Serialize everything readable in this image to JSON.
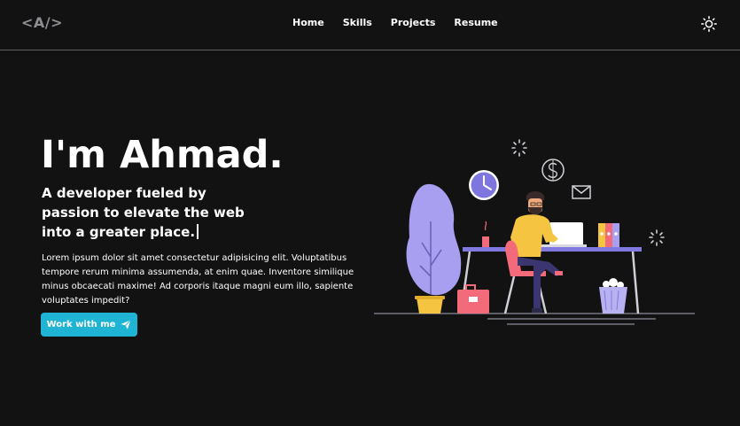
{
  "navbar": {
    "logo": "<A/>",
    "links": [
      {
        "label": "Home"
      },
      {
        "label": "Skills"
      },
      {
        "label": "Projects"
      },
      {
        "label": "Resume"
      }
    ],
    "theme_toggle_icon": "sun-icon"
  },
  "hero": {
    "title": "I'm Ahmad.",
    "subtitle": "A developer fueled by passion to elevate the web into a greater place.",
    "body": "Lorem ipsum dolor sit amet consectetur adipisicing elit. Voluptatibus tempore rerum minima assumenda, at enim quae. Inventore similique minus obcaecati maxime! Ad corporis itaque magni eum illo, sapiente voluptates impedit?",
    "cta_label": "Work with me",
    "cta_icon": "paper-plane-icon"
  },
  "colors": {
    "background": "#121213",
    "accent": "#1fb4d3",
    "illustration_purple": "#a89ff0",
    "illustration_yellow": "#f5c542"
  }
}
